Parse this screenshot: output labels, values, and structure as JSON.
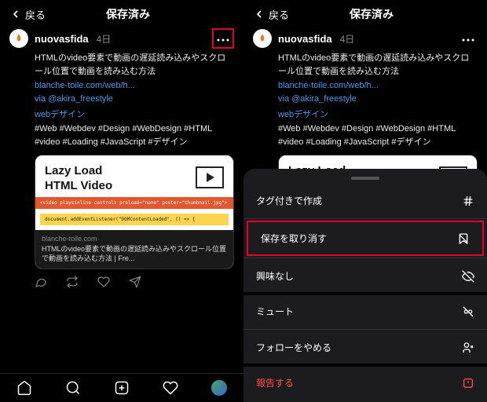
{
  "header": {
    "back": "戻る",
    "title": "保存済み"
  },
  "post": {
    "username": "nuovasfida",
    "time": "4日",
    "body": "HTMLのvideo要素で動画の遅延読み込みやスクロール位置で動画を読み込む方法",
    "url": "blanche-toile.com/web/h...",
    "via_prefix": "via ",
    "via_handle": "@akira_freestyle",
    "topic": "webデザイン",
    "hashtags": "#Web #Webdev #Design #WebDesign #HTML #video #Loading #JavaScript #デザイン"
  },
  "card": {
    "title1": "Lazy Load",
    "title2": "HTML Video",
    "code1": "<video playsinline controls preload=\"none\" poster=\"thumbnail.jpg\">",
    "code2": "document.addEventListener(\"DOMContentLoaded\", () => {",
    "domain": "blanche-toile.com",
    "caption": "HTMLのvideo要素で動画の遅延読み込みやスクロール位置で動画を読み込む方法 | Fre..."
  },
  "sheet": {
    "create": "タグ付きで作成",
    "unsave": "保存を取り消す",
    "notinterested": "興味なし",
    "mute": "ミュート",
    "unfollow": "フォローをやめる",
    "report": "報告する"
  }
}
